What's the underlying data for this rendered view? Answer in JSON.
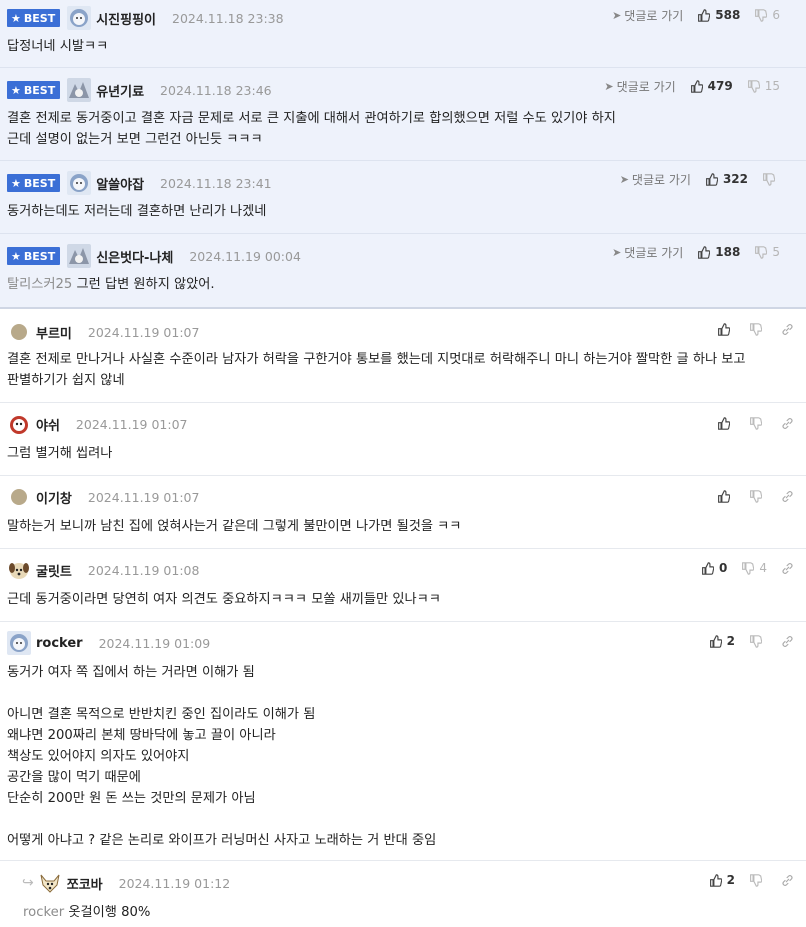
{
  "ui": {
    "reply_label": "댓글로 가기",
    "best_label": "BEST"
  },
  "comments": [
    {
      "nick": "시진핑핑이",
      "date": "2024.11.18 23:38",
      "up": "588",
      "down": "6",
      "lines": [
        "답정너네 시발ㅋㅋ"
      ]
    },
    {
      "nick": "유년기료",
      "date": "2024.11.18 23:46",
      "up": "479",
      "down": "15",
      "lines": [
        "결혼 전제로 동거중이고 결혼 자금 문제로 서로 큰 지출에 대해서 관여하기로 합의했으면 저럴 수도 있기야 하지",
        "근데 설명이 없는거 보면 그런건 아닌듯 ㅋㅋㅋ"
      ]
    },
    {
      "nick": "알쓸야잡",
      "date": "2024.11.18 23:41",
      "up": "322",
      "down": "",
      "lines": [
        "동거하는데도 저러는데 결혼하면 난리가 나겠네"
      ]
    },
    {
      "nick": "신은벗다-나체",
      "date": "2024.11.19 00:04",
      "up": "188",
      "down": "5",
      "mention": "탈리스커25",
      "lines": [
        "그런 답변 원하지 않았어."
      ]
    },
    {
      "nick": "부르미",
      "date": "2024.11.19 01:07",
      "up": "",
      "down": "",
      "lines": [
        "결혼 전제로 만나거나 사실혼 수준이라 남자가 허락을 구한거야 통보를 했는데 지멋대로 허락해주니 마니 하는거야 짤막한 글 하나 보고",
        "판별하기가 쉽지 않네"
      ]
    },
    {
      "nick": "야쉬",
      "date": "2024.11.19 01:07",
      "up": "",
      "down": "",
      "lines": [
        "그럼 별거해 씹려나"
      ]
    },
    {
      "nick": "이기창",
      "date": "2024.11.19 01:07",
      "up": "",
      "down": "",
      "lines": [
        "말하는거 보니까 남친 집에 얹혀사는거 같은데 그렇게 불만이면 나가면 될것을 ㅋㅋ"
      ]
    },
    {
      "nick": "굴릿트",
      "date": "2024.11.19 01:08",
      "up": "0",
      "down": "4",
      "lines": [
        "근데 동거중이라면 당연히 여자 의견도 중요하지ㅋㅋㅋ 모쏠 새끼들만 있나ㅋㅋ"
      ]
    },
    {
      "nick": "rocker",
      "date": "2024.11.19 01:09",
      "up": "2",
      "down": "",
      "lines": [
        "동거가 여자 쪽 집에서 하는 거라면 이해가 됨",
        "",
        "아니면 결혼 목적으로 반반치킨 중인 집이라도 이해가 됨",
        "왜냐면 200짜리 본체 땅바닥에 놓고 끌이 아니라",
        "책상도 있어야지 의자도 있어야지",
        "공간을 많이 먹기 때문에",
        "단순히 200만 원 돈 쓰는 것만의 문제가 아님",
        "",
        "어떻게 아냐고 ? 같은 논리로 와이프가 러닝머신 사자고 노래하는 거 반대 중임"
      ]
    },
    {
      "nick": "쪼코바",
      "date": "2024.11.19 01:12",
      "up": "2",
      "down": "",
      "mention": "rocker",
      "lines": [
        "옷걸이행 80%"
      ]
    }
  ]
}
